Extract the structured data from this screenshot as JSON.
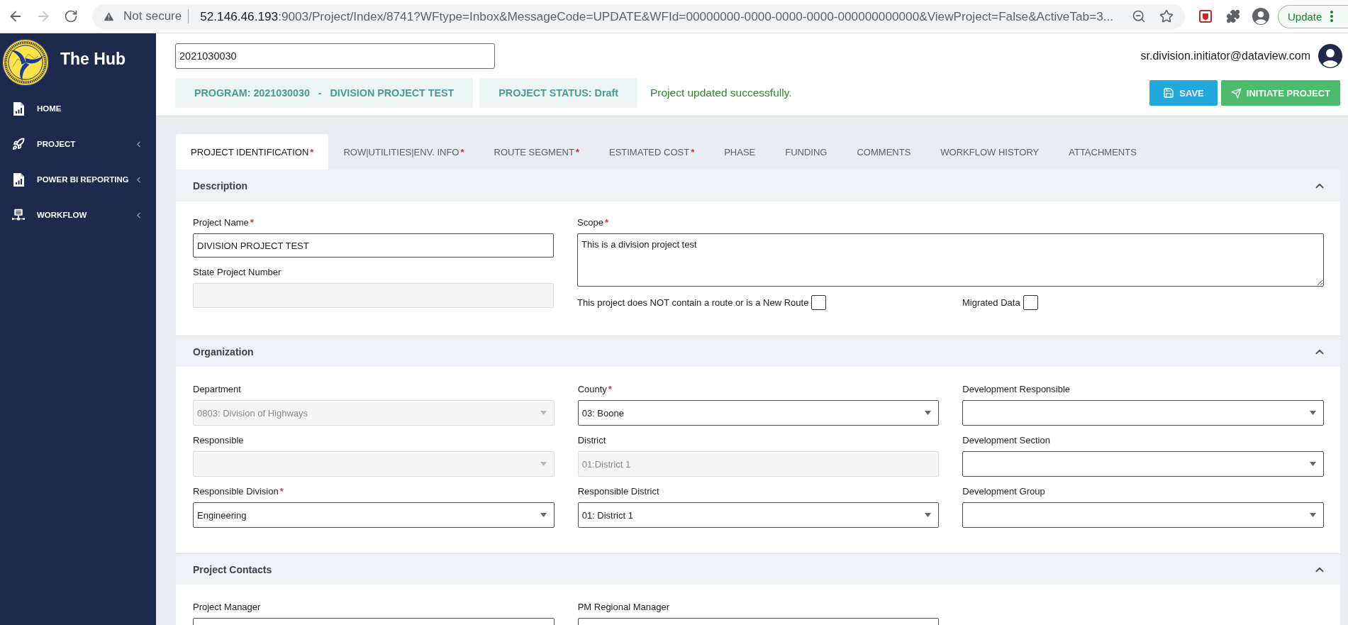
{
  "browser": {
    "forward_enabled": false,
    "security_label": "Not secure",
    "url_host": "52.146.46.193",
    "url_rest": ":9003/Project/Index/8741?WFtype=Inbox&MessageCode=UPDATE&WFId=00000000-0000-0000-0000-000000000000&ViewProject=False&ActiveTab=3...",
    "bookmarked": false,
    "update_label": "Update"
  },
  "sidebar": {
    "title": "The Hub",
    "items": [
      {
        "label": "HOME",
        "has_submenu": false
      },
      {
        "label": "PROJECT",
        "has_submenu": true
      },
      {
        "label": "POWER BI REPORTING",
        "has_submenu": true
      },
      {
        "label": "WORKFLOW",
        "has_submenu": true
      }
    ]
  },
  "header": {
    "search_value": "2021030030",
    "user_email": "sr.division.initiator@dataview.com",
    "program": "PROGRAM: 2021030030   -   DIVISION PROJECT TEST",
    "status": "PROJECT STATUS: Draft",
    "message": "Project updated successfully.",
    "buttons": [
      {
        "label": "SAVE",
        "kind": "save"
      },
      {
        "label": "INITIATE PROJECT",
        "kind": "initiate"
      }
    ]
  },
  "tabs": [
    {
      "label": "PROJECT IDENTIFICATION",
      "required_mark": "*",
      "selected": true
    },
    {
      "label": "ROW|UTILITIES|ENV. INFO",
      "required_mark": "*",
      "selected": false
    },
    {
      "label": "ROUTE SEGMENT",
      "required_mark": "*",
      "selected": false
    },
    {
      "label": "ESTIMATED COST",
      "required_mark": "*",
      "selected": false
    },
    {
      "label": "PHASE",
      "selected": false
    },
    {
      "label": "FUNDING",
      "selected": false
    },
    {
      "label": "COMMENTS",
      "selected": false
    },
    {
      "label": "WORKFLOW HISTORY",
      "selected": false
    },
    {
      "label": "ATTACHMENTS",
      "selected": false
    }
  ],
  "description": {
    "title": "Description",
    "expanded": true,
    "project_name": {
      "label": "Project Name",
      "required_mark": "*",
      "value": "DIVISION PROJECT TEST",
      "disabled": false
    },
    "state_project_number": {
      "label": "State Project Number",
      "disabled": true
    },
    "scope": {
      "label": "Scope",
      "required_mark": "*",
      "value": "This is a division project test",
      "disabled": false
    },
    "checkboxes": [
      {
        "label": "This project does NOT contain a route or is a New Route",
        "checked": false
      },
      {
        "label": "Migrated Data",
        "checked": false
      }
    ]
  },
  "organization": {
    "title": "Organization",
    "expanded": true,
    "fields": [
      {
        "label": "Department",
        "kind": "select",
        "disabled": true,
        "value": "0803: Division of Highways"
      },
      {
        "label": "County",
        "required_mark": "*",
        "kind": "select",
        "disabled": false,
        "value": "03: Boone"
      },
      {
        "label": "Development Responsible",
        "kind": "select",
        "disabled": false
      },
      {
        "label": "Responsible",
        "kind": "select",
        "disabled": true
      },
      {
        "label": "District",
        "kind": "text",
        "disabled": true,
        "value": "01:District 1"
      },
      {
        "label": "Development Section",
        "kind": "select",
        "disabled": false
      },
      {
        "label": "Responsible Division",
        "required_mark": "*",
        "kind": "select",
        "disabled": false,
        "value": "Engineering"
      },
      {
        "label": "Responsible District",
        "kind": "select",
        "disabled": false,
        "value": "01: District 1"
      },
      {
        "label": "Development Group",
        "kind": "select",
        "disabled": false
      }
    ]
  },
  "project_contacts": {
    "title": "Project Contacts",
    "expanded": true,
    "fields": [
      {
        "label": "Project Manager",
        "kind": "text",
        "disabled": false
      },
      {
        "label": "PM Regional Manager",
        "kind": "text",
        "disabled": false
      }
    ]
  }
}
